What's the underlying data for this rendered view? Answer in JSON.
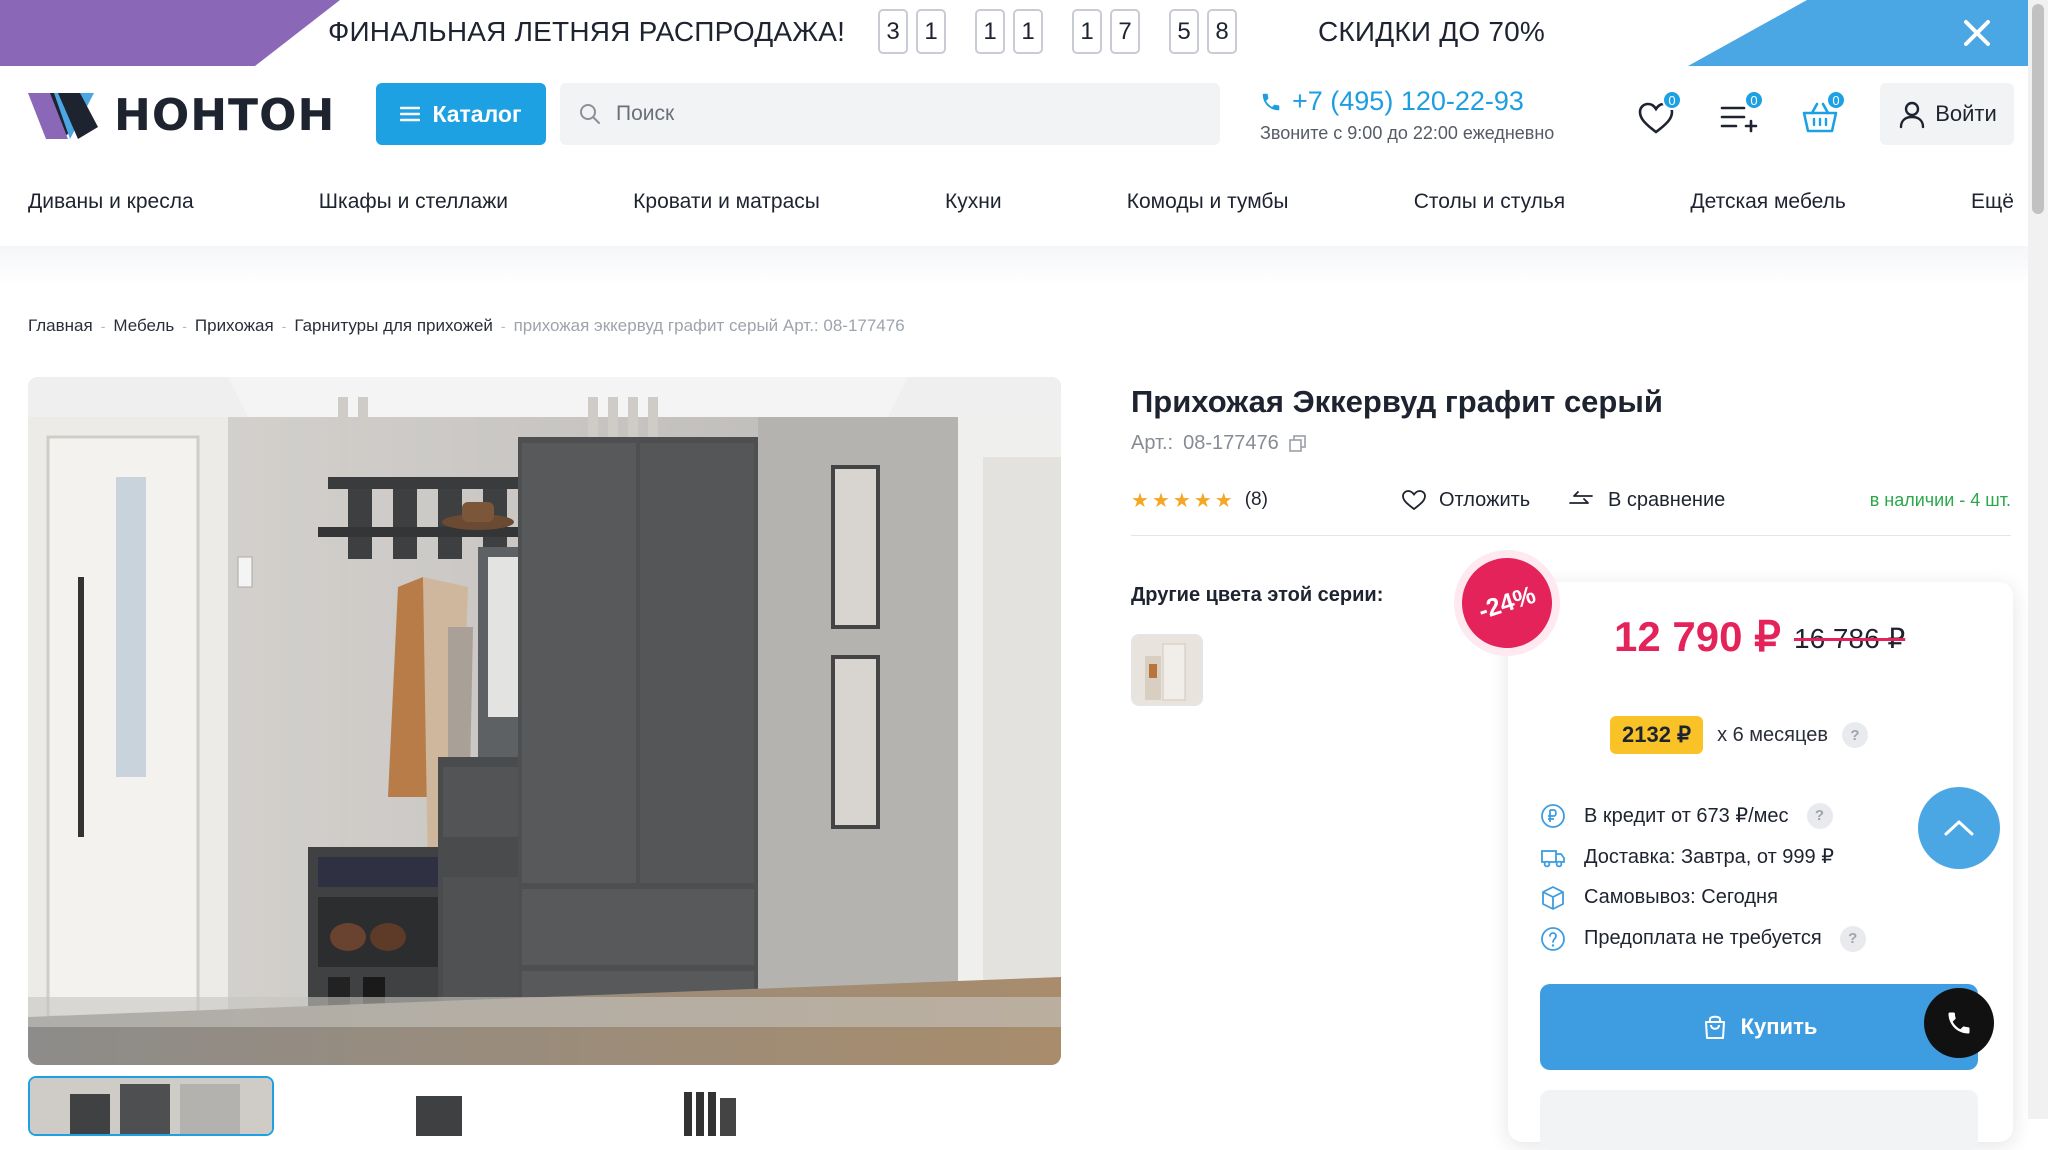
{
  "promo": {
    "title": "ФИНАЛЬНАЯ ЛЕТНЯЯ РАСПРОДАЖА!",
    "timer_digits": [
      [
        "3",
        "1"
      ],
      [
        "1",
        "1"
      ],
      [
        "1",
        "7"
      ],
      [
        "5",
        "8"
      ]
    ],
    "discount_text": "СКИДКИ ДО 70%",
    "colors": {
      "left": "#8a68b7",
      "right": "#4ba7e3"
    }
  },
  "header": {
    "logo_text": "НОНТОН",
    "catalog_label": "Каталог",
    "search_placeholder": "Поиск",
    "phone_number": "+7 (495) 120-22-93",
    "phone_hours": "Звоните с 9:00 до 22:00 ежедневно",
    "favorites_count": "0",
    "compare_count": "0",
    "cart_count": "0",
    "login_label": "Войти",
    "accent": "#1da1e2"
  },
  "categories": [
    "Диваны и кресла",
    "Шкафы и стеллажи",
    "Кровати и матрасы",
    "Кухни",
    "Комоды и тумбы",
    "Столы и стулья",
    "Детская мебель",
    "Ещё"
  ],
  "breadcrumb": [
    "Главная",
    "Мебель",
    "Прихожая",
    "Гарнитуры для прихожей",
    "прихожая эккервуд графит серый Арт.: 08-177476"
  ],
  "product": {
    "title": "Прихожая Эккервуд графит серый",
    "article_label": "Арт.:",
    "article": "08-177476",
    "stars": [
      "★",
      "★",
      "★",
      "★",
      "★"
    ],
    "reviews": "(8)",
    "wishlist_label": "Отложить",
    "compare_label": "В сравнение",
    "stock": "в наличии - 4 шт.",
    "other_colors_label": "Другие цвета этой серии:"
  },
  "price": {
    "discount": "-24%",
    "current": "12 790 ₽",
    "old": "16 786 ₽",
    "installment_amount": "2132 ₽",
    "installment_term": "х 6 месяцев",
    "help_mark": "?",
    "info": [
      {
        "icon": "ruble-circle-icon",
        "text": "В кредит от 673 ₽/мес",
        "help": true
      },
      {
        "icon": "truck-icon",
        "text": "Доставка: Завтра, от 999 ₽",
        "help": false
      },
      {
        "icon": "box-icon",
        "text": "Самовывоз: Сегодня",
        "help": false
      },
      {
        "icon": "question-circle-icon",
        "text": "Предоплата не требуется",
        "help": true
      }
    ],
    "buy_label": "Купить",
    "accent": "#e5235b"
  }
}
